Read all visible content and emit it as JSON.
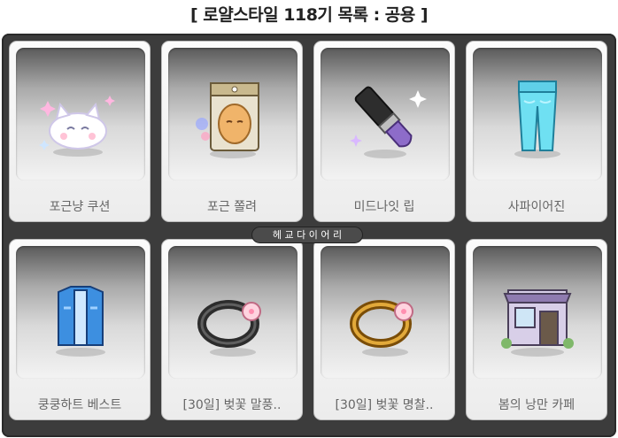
{
  "page_title": "[ 로얄스타일 118기 목록 : 공용 ]",
  "badge": "헤 교 다 이 어 리",
  "items": [
    {
      "name": "포근냥 쿠션",
      "icon": "cat-cushion-icon"
    },
    {
      "name": "포근 쫄려",
      "icon": "face-mask-pack-icon"
    },
    {
      "name": "미드나잇 립",
      "icon": "lipstick-icon"
    },
    {
      "name": "사파이어진",
      "icon": "jeans-icon"
    },
    {
      "name": "쿵쿵하트 베스트",
      "icon": "vest-icon"
    },
    {
      "name": "[30일] 벚꽃 말풍..",
      "icon": "black-ring-icon"
    },
    {
      "name": "[30일] 벚꽃 명찰..",
      "icon": "gold-ring-icon"
    },
    {
      "name": "봄의 낭만 카페",
      "icon": "cafe-icon"
    }
  ]
}
